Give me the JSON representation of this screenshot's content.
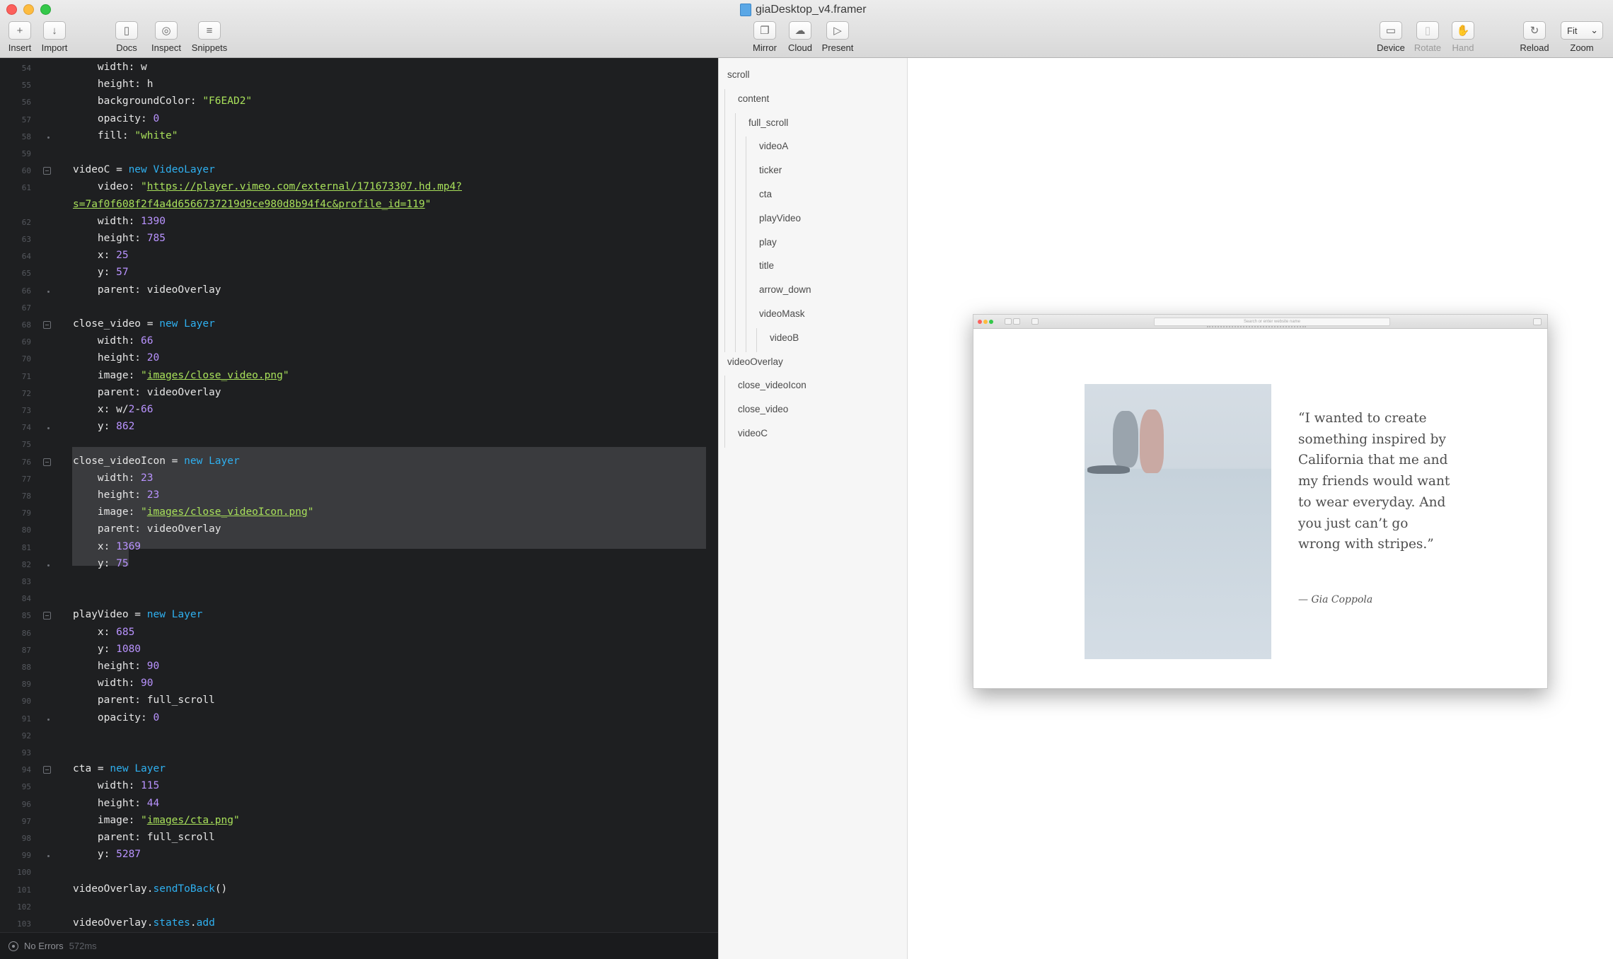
{
  "window": {
    "title": "giaDesktop_v4.framer"
  },
  "toolbar": {
    "insert": "Insert",
    "import": "Import",
    "docs": "Docs",
    "inspect": "Inspect",
    "snippets": "Snippets",
    "mirror": "Mirror",
    "cloud": "Cloud",
    "present": "Present",
    "device": "Device",
    "rotate": "Rotate",
    "hand": "Hand",
    "reload": "Reload",
    "zoom_label": "Zoom",
    "zoom_value": "Fit"
  },
  "editor": {
    "lines": [
      {
        "n": "54",
        "tokens": [
          {
            "t": "    width: w",
            "c": ""
          }
        ]
      },
      {
        "n": "55",
        "tokens": [
          {
            "t": "    height: h",
            "c": ""
          }
        ]
      },
      {
        "n": "56",
        "tokens": [
          {
            "t": "    backgroundColor: ",
            "c": ""
          },
          {
            "t": "\"F6EAD2\"",
            "c": "str"
          }
        ]
      },
      {
        "n": "57",
        "tokens": [
          {
            "t": "    opacity: ",
            "c": ""
          },
          {
            "t": "0",
            "c": "num"
          }
        ]
      },
      {
        "n": "58",
        "tokens": [
          {
            "t": "    fill: ",
            "c": ""
          },
          {
            "t": "\"white\"",
            "c": "str"
          }
        ]
      },
      {
        "n": "59",
        "tokens": []
      },
      {
        "n": "60",
        "tokens": [
          {
            "t": "videoC = ",
            "c": ""
          },
          {
            "t": "new",
            "c": "kw"
          },
          {
            "t": " ",
            "c": ""
          },
          {
            "t": "VideoLayer",
            "c": "kw"
          }
        ]
      },
      {
        "n": "61",
        "tokens": [
          {
            "t": "    video: ",
            "c": ""
          },
          {
            "t": "\"",
            "c": "str"
          },
          {
            "t": "https://player.vimeo.com/external/171673307.hd.mp4?",
            "c": "url"
          }
        ]
      },
      {
        "n": "",
        "tokens": [
          {
            "t": "s=7af0f608f2f4a4d6566737219d9ce980d8b94f4c&profile_id=119",
            "c": "url"
          },
          {
            "t": "\"",
            "c": "str"
          }
        ]
      },
      {
        "n": "62",
        "tokens": [
          {
            "t": "    width: ",
            "c": ""
          },
          {
            "t": "1390",
            "c": "num"
          }
        ]
      },
      {
        "n": "63",
        "tokens": [
          {
            "t": "    height: ",
            "c": ""
          },
          {
            "t": "785",
            "c": "num"
          }
        ]
      },
      {
        "n": "64",
        "tokens": [
          {
            "t": "    x: ",
            "c": ""
          },
          {
            "t": "25",
            "c": "num"
          }
        ]
      },
      {
        "n": "65",
        "tokens": [
          {
            "t": "    y: ",
            "c": ""
          },
          {
            "t": "57",
            "c": "num"
          }
        ]
      },
      {
        "n": "66",
        "tokens": [
          {
            "t": "    parent: videoOverlay",
            "c": ""
          }
        ]
      },
      {
        "n": "67",
        "tokens": []
      },
      {
        "n": "68",
        "tokens": [
          {
            "t": "close_video = ",
            "c": ""
          },
          {
            "t": "new",
            "c": "kw"
          },
          {
            "t": " ",
            "c": ""
          },
          {
            "t": "Layer",
            "c": "kw"
          }
        ]
      },
      {
        "n": "69",
        "tokens": [
          {
            "t": "    width: ",
            "c": ""
          },
          {
            "t": "66",
            "c": "num"
          }
        ]
      },
      {
        "n": "70",
        "tokens": [
          {
            "t": "    height: ",
            "c": ""
          },
          {
            "t": "20",
            "c": "num"
          }
        ]
      },
      {
        "n": "71",
        "tokens": [
          {
            "t": "    image: ",
            "c": ""
          },
          {
            "t": "\"",
            "c": "str"
          },
          {
            "t": "images/close_video.png",
            "c": "url"
          },
          {
            "t": "\"",
            "c": "str"
          }
        ]
      },
      {
        "n": "72",
        "tokens": [
          {
            "t": "    parent: videoOverlay",
            "c": ""
          }
        ]
      },
      {
        "n": "73",
        "tokens": [
          {
            "t": "    x: w/",
            "c": ""
          },
          {
            "t": "2",
            "c": "num"
          },
          {
            "t": "-",
            "c": ""
          },
          {
            "t": "66",
            "c": "num"
          }
        ]
      },
      {
        "n": "74",
        "tokens": [
          {
            "t": "    y: ",
            "c": ""
          },
          {
            "t": "862",
            "c": "num"
          }
        ]
      },
      {
        "n": "75",
        "tokens": []
      },
      {
        "n": "76",
        "tokens": [
          {
            "t": "close_videoIcon = ",
            "c": ""
          },
          {
            "t": "new",
            "c": "kw"
          },
          {
            "t": " ",
            "c": ""
          },
          {
            "t": "Layer",
            "c": "kw"
          }
        ]
      },
      {
        "n": "77",
        "tokens": [
          {
            "t": "    width: ",
            "c": ""
          },
          {
            "t": "23",
            "c": "num"
          }
        ]
      },
      {
        "n": "78",
        "tokens": [
          {
            "t": "    height: ",
            "c": ""
          },
          {
            "t": "23",
            "c": "num"
          }
        ]
      },
      {
        "n": "79",
        "tokens": [
          {
            "t": "    image: ",
            "c": ""
          },
          {
            "t": "\"",
            "c": "str"
          },
          {
            "t": "images/close_videoIcon.png",
            "c": "url"
          },
          {
            "t": "\"",
            "c": "str"
          }
        ]
      },
      {
        "n": "80",
        "tokens": [
          {
            "t": "    parent: videoOverlay",
            "c": ""
          }
        ]
      },
      {
        "n": "81",
        "tokens": [
          {
            "t": "    x: ",
            "c": ""
          },
          {
            "t": "1369",
            "c": "num"
          }
        ]
      },
      {
        "n": "82",
        "tokens": [
          {
            "t": "    y: ",
            "c": ""
          },
          {
            "t": "75",
            "c": "num"
          }
        ]
      },
      {
        "n": "83",
        "tokens": []
      },
      {
        "n": "84",
        "tokens": []
      },
      {
        "n": "85",
        "tokens": [
          {
            "t": "playVideo = ",
            "c": ""
          },
          {
            "t": "new",
            "c": "kw"
          },
          {
            "t": " ",
            "c": ""
          },
          {
            "t": "Layer",
            "c": "kw"
          }
        ]
      },
      {
        "n": "86",
        "tokens": [
          {
            "t": "    x: ",
            "c": ""
          },
          {
            "t": "685",
            "c": "num"
          }
        ]
      },
      {
        "n": "87",
        "tokens": [
          {
            "t": "    y: ",
            "c": ""
          },
          {
            "t": "1080",
            "c": "num"
          }
        ]
      },
      {
        "n": "88",
        "tokens": [
          {
            "t": "    height: ",
            "c": ""
          },
          {
            "t": "90",
            "c": "num"
          }
        ]
      },
      {
        "n": "89",
        "tokens": [
          {
            "t": "    width: ",
            "c": ""
          },
          {
            "t": "90",
            "c": "num"
          }
        ]
      },
      {
        "n": "90",
        "tokens": [
          {
            "t": "    parent: full_scroll",
            "c": ""
          }
        ]
      },
      {
        "n": "91",
        "tokens": [
          {
            "t": "    opacity: ",
            "c": ""
          },
          {
            "t": "0",
            "c": "num"
          }
        ]
      },
      {
        "n": "92",
        "tokens": []
      },
      {
        "n": "93",
        "tokens": []
      },
      {
        "n": "94",
        "tokens": [
          {
            "t": "cta = ",
            "c": ""
          },
          {
            "t": "new",
            "c": "kw"
          },
          {
            "t": " ",
            "c": ""
          },
          {
            "t": "Layer",
            "c": "kw"
          }
        ]
      },
      {
        "n": "95",
        "tokens": [
          {
            "t": "    width: ",
            "c": ""
          },
          {
            "t": "115",
            "c": "num"
          }
        ]
      },
      {
        "n": "96",
        "tokens": [
          {
            "t": "    height: ",
            "c": ""
          },
          {
            "t": "44",
            "c": "num"
          }
        ]
      },
      {
        "n": "97",
        "tokens": [
          {
            "t": "    image: ",
            "c": ""
          },
          {
            "t": "\"",
            "c": "str"
          },
          {
            "t": "images/cta.png",
            "c": "url"
          },
          {
            "t": "\"",
            "c": "str"
          }
        ]
      },
      {
        "n": "98",
        "tokens": [
          {
            "t": "    parent: full_scroll",
            "c": ""
          }
        ]
      },
      {
        "n": "99",
        "tokens": [
          {
            "t": "    y: ",
            "c": ""
          },
          {
            "t": "5287",
            "c": "num"
          }
        ]
      },
      {
        "n": "100",
        "tokens": []
      },
      {
        "n": "101",
        "tokens": [
          {
            "t": "videoOverlay.",
            "c": ""
          },
          {
            "t": "sendToBack",
            "c": "kw"
          },
          {
            "t": "()",
            "c": ""
          }
        ]
      },
      {
        "n": "102",
        "tokens": []
      },
      {
        "n": "103",
        "tokens": [
          {
            "t": "videoOverlay.",
            "c": ""
          },
          {
            "t": "states",
            "c": "kw"
          },
          {
            "t": ".",
            "c": ""
          },
          {
            "t": "add",
            "c": "kw"
          }
        ]
      }
    ]
  },
  "status": {
    "text": "No Errors",
    "time": "572ms"
  },
  "layers": [
    {
      "name": "scroll",
      "depth": 0
    },
    {
      "name": "content",
      "depth": 1
    },
    {
      "name": "full_scroll",
      "depth": 2
    },
    {
      "name": "videoA",
      "depth": 3
    },
    {
      "name": "ticker",
      "depth": 3
    },
    {
      "name": "cta",
      "depth": 3
    },
    {
      "name": "playVideo",
      "depth": 3
    },
    {
      "name": "play",
      "depth": 3
    },
    {
      "name": "title",
      "depth": 3
    },
    {
      "name": "arrow_down",
      "depth": 3
    },
    {
      "name": "videoMask",
      "depth": 3
    },
    {
      "name": "videoB",
      "depth": 4
    },
    {
      "name": "videoOverlay",
      "depth": 0
    },
    {
      "name": "close_videoIcon",
      "depth": 1
    },
    {
      "name": "close_video",
      "depth": 1
    },
    {
      "name": "videoC",
      "depth": 1
    }
  ],
  "preview": {
    "url_placeholder": "Search or enter website name",
    "quote": "“I wanted to create something inspired by California that me and my friends would want to wear everyday. And you just can’t go wrong with stripes.”",
    "signature": "— Gia Coppola"
  }
}
